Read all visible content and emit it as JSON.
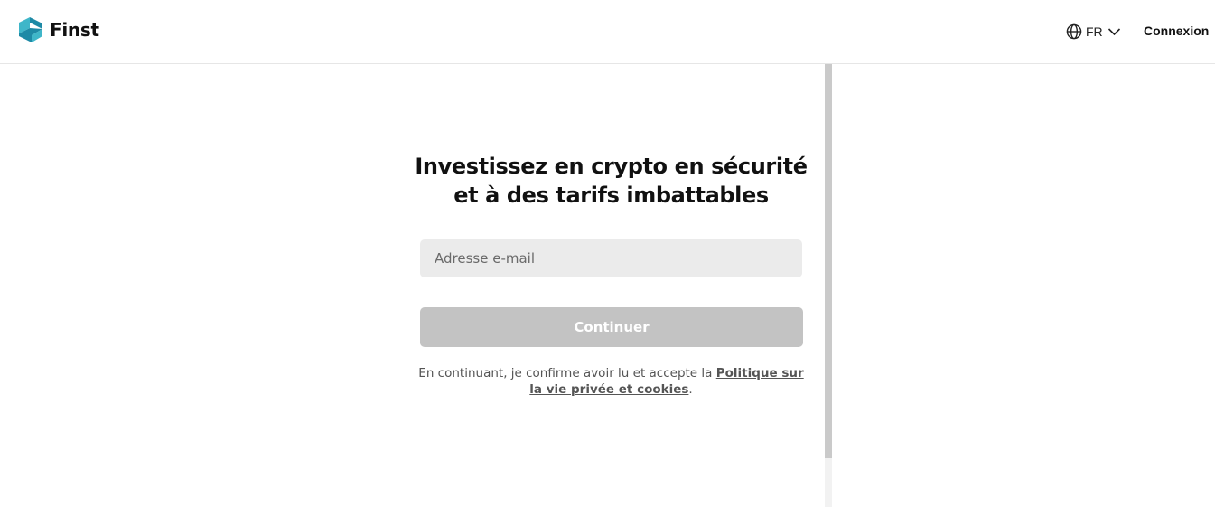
{
  "header": {
    "logo_text": "Finst",
    "logo_icon": "finst-logo-icon",
    "language": {
      "icon": "globe-icon",
      "label": "FR",
      "dropdown_icon": "chevron-down-icon"
    },
    "login_label": "Connexion"
  },
  "main": {
    "title_line1": "Investissez en crypto en sécurité",
    "title_line2": "et à des tarifs imbattables",
    "email_placeholder": "Adresse e-mail",
    "email_value": "",
    "continue_label": "Continuer",
    "consent_prefix": "En continuant, je confirme avoir lu et accepte la ",
    "consent_link": "Politique sur la vie privée et cookies",
    "consent_suffix": "."
  },
  "colors": {
    "brand_teal": "#1e8aa6",
    "brand_teal_light": "#3fb6c9",
    "button_disabled": "#c3c3c3",
    "input_bg": "#ebebeb",
    "divider": "#cacaca"
  }
}
